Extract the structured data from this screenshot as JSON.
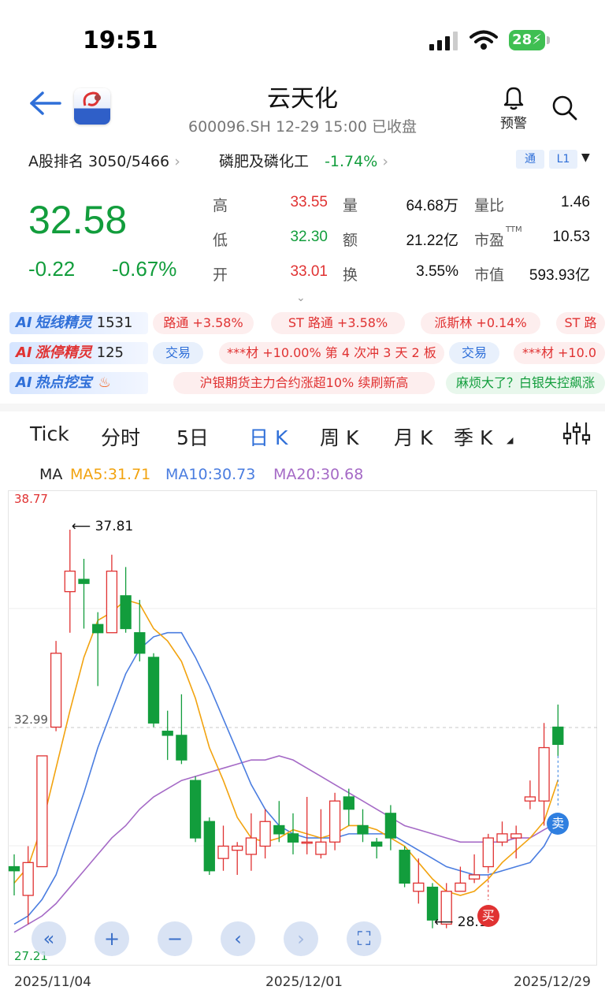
{
  "status": {
    "time": "19:51",
    "battery": "28"
  },
  "header": {
    "title": "云天化",
    "subtitle": "600096.SH 12-29 15:00 已收盘",
    "alert_label": "预警"
  },
  "rank": {
    "label": "A股排名 3050/5466",
    "sector": "磷肥及磷化工",
    "sector_change": "-1.74%",
    "chip_tong": "通",
    "chip_level": "L1"
  },
  "quote": {
    "price": "32.58",
    "change": "-0.22",
    "change_pct": "-0.67%",
    "grid": [
      [
        {
          "label": "高",
          "value": "33.55",
          "color": "red"
        },
        {
          "label": "量",
          "value": "64.68万",
          "color": "dark"
        },
        {
          "label": "量比",
          "value": "1.46",
          "color": "dark"
        }
      ],
      [
        {
          "label": "低",
          "value": "32.30",
          "color": "green"
        },
        {
          "label": "额",
          "value": "21.22亿",
          "color": "dark"
        },
        {
          "label": "市盈",
          "sup": "TTM",
          "value": "10.53",
          "color": "dark"
        }
      ],
      [
        {
          "label": "开",
          "value": "33.01",
          "color": "red"
        },
        {
          "label": "换",
          "value": "3.55%",
          "color": "dark"
        },
        {
          "label": "市值",
          "value": "593.93亿",
          "color": "dark"
        }
      ]
    ]
  },
  "ai_rows": [
    {
      "badge_ai": "AI",
      "badge_name": "短线精灵",
      "badge_count": "1531",
      "tags": [
        {
          "text": "路通 +3.58%",
          "style": "red"
        },
        {
          "text": "ST 路通 +3.58%",
          "style": "red"
        },
        {
          "text": "派斯林 +0.14%",
          "style": "red"
        },
        {
          "text": "ST 路",
          "style": "red"
        }
      ]
    },
    {
      "badge_ai": "AI",
      "badge_name": "涨停精灵",
      "badge_count": "125",
      "tags": [
        {
          "text": "交易",
          "style": "blue"
        },
        {
          "text": "***材 +10.00% 第 4 次冲 3 天 2 板",
          "style": "red"
        },
        {
          "text": "交易",
          "style": "blue"
        },
        {
          "text": "***材 +10.0",
          "style": "red"
        }
      ]
    },
    {
      "badge_ai": "AI",
      "badge_name": "热点挖宝",
      "badge_count": "",
      "tags": [
        {
          "text": "沪银期货主力合约涨超10% 续刷新高",
          "style": "red"
        },
        {
          "text": "麻烦大了？白银失控飙涨",
          "style": "green"
        }
      ]
    }
  ],
  "tabs": [
    "Tick",
    "分时",
    "5日",
    "日 K",
    "周 K",
    "月 K",
    "季 K"
  ],
  "active_tab": "日 K",
  "ma": {
    "label": "MA",
    "ma5": "MA5:31.71",
    "ma10": "MA10:30.73",
    "ma20": "MA20:30.68"
  },
  "colors": {
    "up": "#e03232",
    "down": "#129d3c",
    "accent": "#2f6fd8",
    "ma5": "#f2a30f",
    "ma10": "#4a7de0",
    "ma20": "#a56ac6"
  },
  "chart_data": {
    "type": "candlestick",
    "ylim": [
      27.21,
      38.77
    ],
    "y_top_label": "38.77",
    "y_bottom_label": "27.21",
    "ref_line": 32.99,
    "ref_label": "32.99",
    "max_annot": "37.81",
    "min_annot": "28.17",
    "max_value": 37.81,
    "min_value": 28.17,
    "x_labels": [
      "2025/11/04",
      "2025/12/01",
      "2025/12/29"
    ],
    "buy_label": "买",
    "sell_label": "卖",
    "candles": [
      {
        "o": 29.6,
        "c": 29.5,
        "h": 29.9,
        "l": 28.9
      },
      {
        "o": 28.9,
        "c": 29.7,
        "h": 30.1,
        "l": 28.2
      },
      {
        "o": 29.6,
        "c": 32.3,
        "h": 32.3,
        "l": 29.6
      },
      {
        "o": 33.0,
        "c": 34.8,
        "h": 35.1,
        "l": 32.9
      },
      {
        "o": 36.3,
        "c": 36.8,
        "h": 37.81,
        "l": 35.3
      },
      {
        "o": 36.6,
        "c": 36.5,
        "h": 37.1,
        "l": 35.4
      },
      {
        "o": 35.5,
        "c": 35.3,
        "h": 35.8,
        "l": 34.0
      },
      {
        "o": 35.3,
        "c": 36.8,
        "h": 37.2,
        "l": 35.3
      },
      {
        "o": 36.2,
        "c": 35.4,
        "h": 36.9,
        "l": 35.3
      },
      {
        "o": 35.3,
        "c": 34.8,
        "h": 36.1,
        "l": 34.6
      },
      {
        "o": 34.7,
        "c": 33.1,
        "h": 34.8,
        "l": 33.0
      },
      {
        "o": 32.9,
        "c": 32.8,
        "h": 33.4,
        "l": 32.2
      },
      {
        "o": 32.8,
        "c": 32.2,
        "h": 33.8,
        "l": 32.1
      },
      {
        "o": 31.7,
        "c": 30.3,
        "h": 31.8,
        "l": 30.2
      },
      {
        "o": 30.7,
        "c": 29.5,
        "h": 30.8,
        "l": 29.4
      },
      {
        "o": 29.8,
        "c": 30.1,
        "h": 30.6,
        "l": 29.5
      },
      {
        "o": 30.0,
        "c": 30.1,
        "h": 30.2,
        "l": 29.4
      },
      {
        "o": 29.9,
        "c": 30.3,
        "h": 30.9,
        "l": 29.5
      },
      {
        "o": 30.1,
        "c": 30.7,
        "h": 31.0,
        "l": 29.8
      },
      {
        "o": 30.6,
        "c": 30.4,
        "h": 31.2,
        "l": 30.2
      },
      {
        "o": 30.4,
        "c": 30.2,
        "h": 30.9,
        "l": 29.9
      },
      {
        "o": 30.2,
        "c": 30.2,
        "h": 31.3,
        "l": 29.9
      },
      {
        "o": 29.9,
        "c": 30.2,
        "h": 31.0,
        "l": 29.8
      },
      {
        "o": 30.2,
        "c": 31.2,
        "h": 31.4,
        "l": 30.0
      },
      {
        "o": 31.3,
        "c": 31.0,
        "h": 31.5,
        "l": 30.6
      },
      {
        "o": 30.6,
        "c": 30.4,
        "h": 31.0,
        "l": 30.2
      },
      {
        "o": 30.2,
        "c": 30.1,
        "h": 30.3,
        "l": 29.8
      },
      {
        "o": 30.9,
        "c": 30.3,
        "h": 31.1,
        "l": 30.0
      },
      {
        "o": 30.0,
        "c": 29.2,
        "h": 30.1,
        "l": 29.1
      },
      {
        "o": 29.0,
        "c": 29.2,
        "h": 29.8,
        "l": 28.7
      },
      {
        "o": 29.1,
        "c": 28.3,
        "h": 29.2,
        "l": 28.1
      },
      {
        "o": 28.2,
        "c": 29.0,
        "h": 29.2,
        "l": 28.1
      },
      {
        "o": 29.0,
        "c": 29.2,
        "h": 29.6,
        "l": 29.0
      },
      {
        "o": 29.3,
        "c": 29.4,
        "h": 29.9,
        "l": 29.2
      },
      {
        "o": 29.6,
        "c": 30.3,
        "h": 30.4,
        "l": 29.5
      },
      {
        "o": 30.2,
        "c": 30.4,
        "h": 30.7,
        "l": 30.1
      },
      {
        "o": 30.3,
        "c": 30.4,
        "h": 30.6,
        "l": 29.8
      },
      {
        "o": 31.2,
        "c": 31.3,
        "h": 31.7,
        "l": 31.0
      },
      {
        "o": 31.2,
        "c": 32.5,
        "h": 33.1,
        "l": 30.6
      },
      {
        "o": 33.0,
        "c": 32.58,
        "h": 33.55,
        "l": 32.3
      }
    ],
    "ma5": [
      29.2,
      29.6,
      30.6,
      32.0,
      33.4,
      34.7,
      35.6,
      35.8,
      36.1,
      36.0,
      35.4,
      35.1,
      34.6,
      33.7,
      32.5,
      31.7,
      30.8,
      30.3,
      30.2,
      30.3,
      30.5,
      30.4,
      30.3,
      30.4,
      30.6,
      30.6,
      30.5,
      30.3,
      30.1,
      29.7,
      29.3,
      29.0,
      28.9,
      29.0,
      29.3,
      29.7,
      30.0,
      30.3,
      30.7,
      31.71
    ],
    "ma10": [
      28.2,
      28.4,
      28.8,
      29.4,
      30.4,
      31.4,
      32.5,
      33.4,
      34.3,
      34.9,
      35.2,
      35.3,
      35.3,
      34.7,
      34.0,
      33.2,
      32.4,
      31.6,
      31.0,
      30.6,
      30.4,
      30.3,
      30.3,
      30.3,
      30.4,
      30.4,
      30.4,
      30.4,
      30.2,
      30.0,
      29.8,
      29.6,
      29.5,
      29.4,
      29.4,
      29.5,
      29.6,
      29.7,
      30.1,
      30.73
    ],
    "ma20": [
      28.0,
      28.2,
      28.4,
      28.7,
      29.1,
      29.5,
      29.9,
      30.3,
      30.6,
      31.0,
      31.3,
      31.5,
      31.7,
      31.8,
      31.9,
      32.0,
      32.1,
      32.2,
      32.2,
      32.3,
      32.2,
      32.0,
      31.8,
      31.6,
      31.4,
      31.2,
      31.0,
      30.8,
      30.6,
      30.5,
      30.4,
      30.3,
      30.2,
      30.2,
      30.2,
      30.2,
      30.3,
      30.3,
      30.5,
      30.68
    ]
  },
  "controls": [
    {
      "name": "scroll-left-fast-button",
      "glyph": "«"
    },
    {
      "name": "zoom-in-button",
      "glyph": "+"
    },
    {
      "name": "zoom-out-button",
      "glyph": "−"
    },
    {
      "name": "scroll-left-button",
      "glyph": "‹"
    },
    {
      "name": "scroll-right-button",
      "glyph": "›"
    },
    {
      "name": "fullscreen-button",
      "glyph": "⛶"
    }
  ]
}
